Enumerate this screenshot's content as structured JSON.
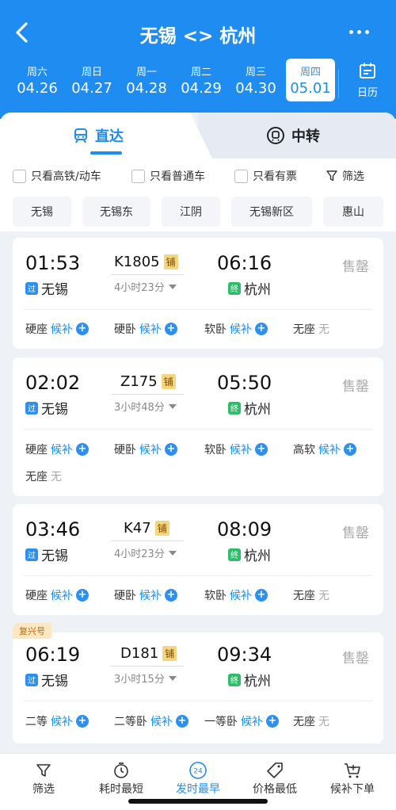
{
  "header": {
    "title": "无锡 <> 杭州",
    "dates": [
      {
        "weekday": "周六",
        "date": "04.26",
        "selected": false
      },
      {
        "weekday": "周日",
        "date": "04.27",
        "selected": false
      },
      {
        "weekday": "周一",
        "date": "04.28",
        "selected": false
      },
      {
        "weekday": "周二",
        "date": "04.29",
        "selected": false
      },
      {
        "weekday": "周三",
        "date": "04.30",
        "selected": false
      },
      {
        "weekday": "周四",
        "date": "05.01",
        "selected": true
      }
    ],
    "calendar_label": "日历"
  },
  "tabs": {
    "direct": "直达",
    "transfer": "中转"
  },
  "filters": {
    "gaotie": "只看高铁/动车",
    "putong": "只看普通车",
    "youpiao": "只看有票",
    "filter": "筛选"
  },
  "stations": [
    "无锡",
    "无锡东",
    "江阴",
    "无锡新区",
    "惠山"
  ],
  "trains": [
    {
      "depart": "01:53",
      "arrive": "06:16",
      "no": "K1805",
      "bunk": "铺",
      "duration": "4小时23分",
      "from": "无锡",
      "to": "杭州",
      "from_tag": "过",
      "to_tag": "终",
      "status": "售罄",
      "badge": "",
      "seats": [
        {
          "name": "硬座",
          "state": "候补"
        },
        {
          "name": "硬卧",
          "state": "候补"
        },
        {
          "name": "软卧",
          "state": "候补"
        },
        {
          "name": "无座",
          "state": "无"
        }
      ]
    },
    {
      "depart": "02:02",
      "arrive": "05:50",
      "no": "Z175",
      "bunk": "铺",
      "duration": "3小时48分",
      "from": "无锡",
      "to": "杭州",
      "from_tag": "过",
      "to_tag": "终",
      "status": "售罄",
      "badge": "",
      "seats": [
        {
          "name": "硬座",
          "state": "候补"
        },
        {
          "name": "硬卧",
          "state": "候补"
        },
        {
          "name": "软卧",
          "state": "候补"
        },
        {
          "name": "高软",
          "state": "候补"
        },
        {
          "name": "无座",
          "state": "无"
        }
      ]
    },
    {
      "depart": "03:46",
      "arrive": "08:09",
      "no": "K47",
      "bunk": "铺",
      "duration": "4小时23分",
      "from": "无锡",
      "to": "杭州",
      "from_tag": "过",
      "to_tag": "终",
      "status": "售罄",
      "badge": "",
      "seats": [
        {
          "name": "硬座",
          "state": "候补"
        },
        {
          "name": "硬卧",
          "state": "候补"
        },
        {
          "name": "软卧",
          "state": "候补"
        },
        {
          "name": "无座",
          "state": "无"
        }
      ]
    },
    {
      "depart": "06:19",
      "arrive": "09:34",
      "no": "D181",
      "bunk": "铺",
      "duration": "3小时15分",
      "from": "无锡",
      "to": "杭州",
      "from_tag": "过",
      "to_tag": "终",
      "status": "售罄",
      "badge": "复兴号",
      "seats": [
        {
          "name": "二等",
          "state": "候补"
        },
        {
          "name": "二等卧",
          "state": "候补"
        },
        {
          "name": "一等卧",
          "state": "候补"
        },
        {
          "name": "无座",
          "state": "无"
        }
      ]
    }
  ],
  "bottom": {
    "filter": "筛选",
    "shortest": "耗时最短",
    "earliest": "发时最早",
    "earliest_icon_text": "24",
    "cheapest": "价格最低",
    "waitlist": "候补下单"
  },
  "colors": {
    "primary": "#1e8cf0",
    "sold": "#aaaaaa",
    "pass_tag": "#2e8ff0",
    "end_tag": "#2fbd6a"
  }
}
